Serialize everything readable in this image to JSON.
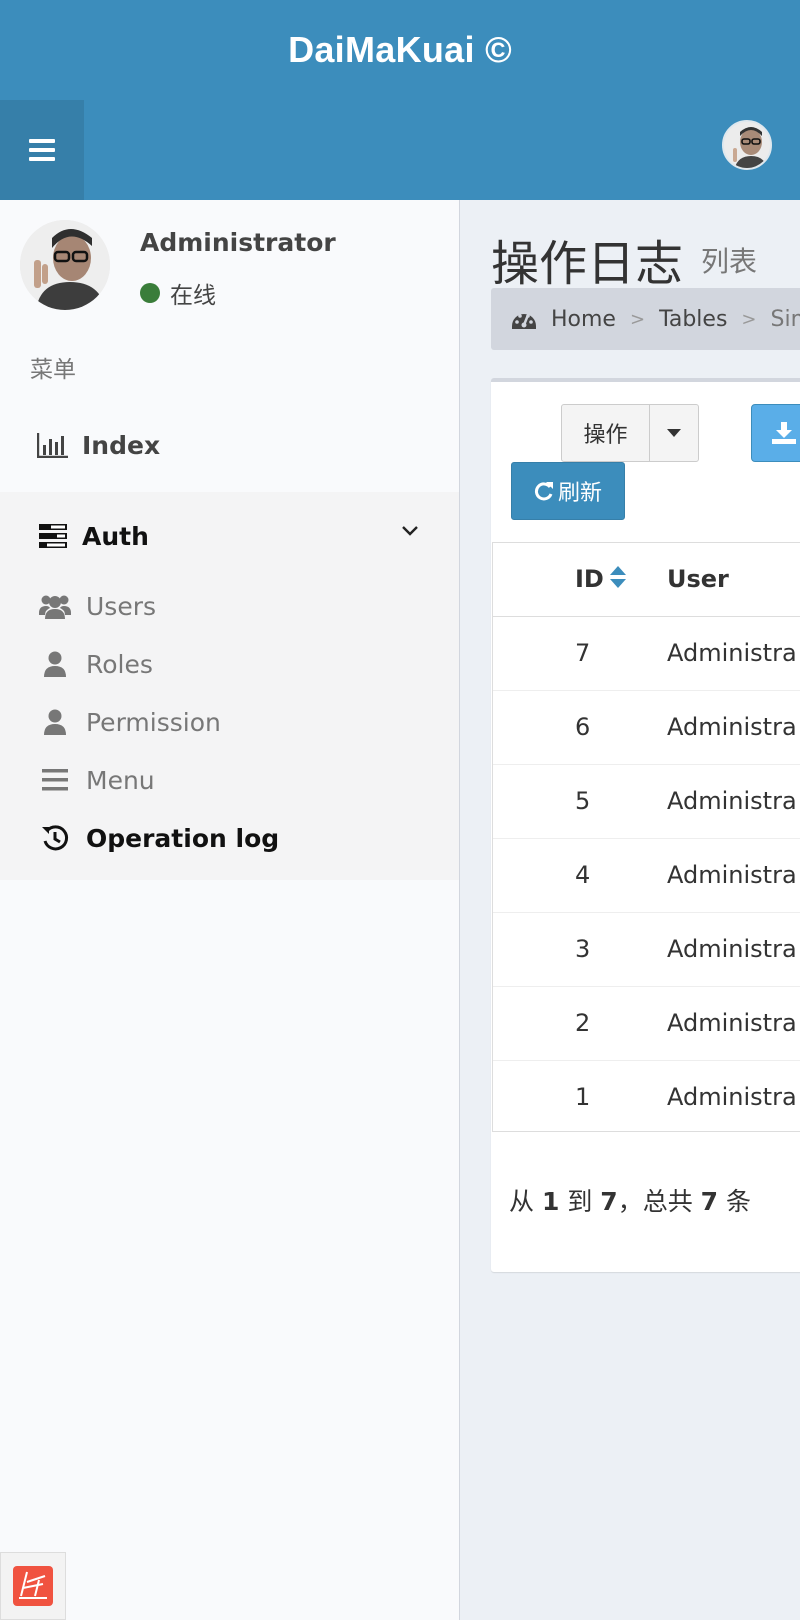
{
  "header": {
    "brand": "DaiMaKuai ©"
  },
  "sidebar": {
    "user": {
      "name": "Administrator",
      "status": "在线"
    },
    "menu_header": "菜单",
    "items": [
      {
        "label": "Index",
        "icon": "bar-chart-icon"
      },
      {
        "label": "Auth",
        "icon": "tasks-icon",
        "expanded": true,
        "children": [
          {
            "label": "Users",
            "icon": "users-icon"
          },
          {
            "label": "Roles",
            "icon": "user-icon"
          },
          {
            "label": "Permission",
            "icon": "user-icon"
          },
          {
            "label": "Menu",
            "icon": "bars-icon"
          },
          {
            "label": "Operation log",
            "icon": "history-icon",
            "active": true
          }
        ]
      }
    ]
  },
  "content": {
    "title": "操作日志",
    "subtitle": "列表",
    "breadcrumb": [
      "Home",
      "Tables",
      "Simp"
    ],
    "toolbar": {
      "action_label": "操作",
      "refresh_label": "刷新"
    },
    "table": {
      "columns": [
        "ID",
        "User"
      ],
      "rows": [
        {
          "id": "7",
          "user": "Administra"
        },
        {
          "id": "6",
          "user": "Administra"
        },
        {
          "id": "5",
          "user": "Administra"
        },
        {
          "id": "4",
          "user": "Administra"
        },
        {
          "id": "3",
          "user": "Administra"
        },
        {
          "id": "2",
          "user": "Administra"
        },
        {
          "id": "1",
          "user": "Administra"
        }
      ]
    },
    "pagination": {
      "prefix": "从",
      "from": "1",
      "mid": "到",
      "to": "7",
      "sep": "，总共",
      "total": "7",
      "suffix": "条"
    }
  },
  "colors": {
    "primary": "#3c8dbc",
    "sidebar_bg": "#f9fafc",
    "content_bg": "#ecf0f5",
    "online": "#3a7d3a"
  }
}
